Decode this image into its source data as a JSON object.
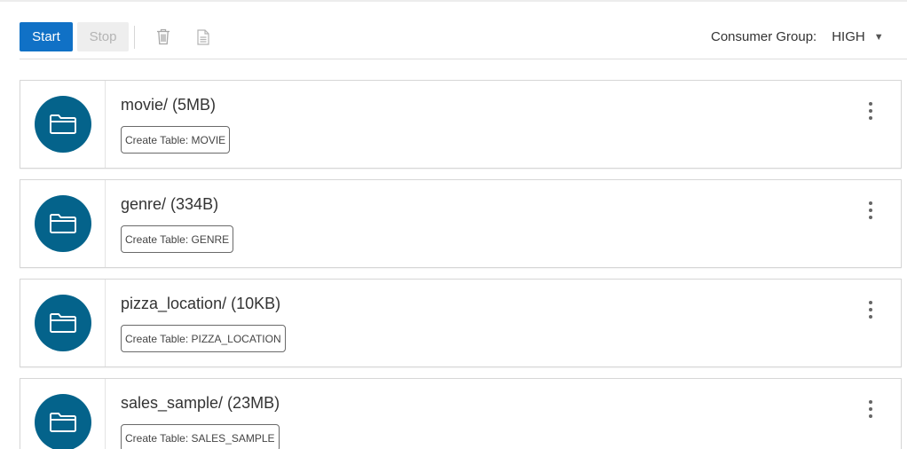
{
  "toolbar": {
    "start_label": "Start",
    "stop_label": "Stop",
    "delete_icon": "trash-icon",
    "log_icon": "document-icon",
    "consumer_group_label": "Consumer Group:",
    "consumer_group_value": "HIGH"
  },
  "colors": {
    "primary": "#1071c6",
    "folder_circle": "#04638b",
    "disabled_bg": "#eeeeee",
    "disabled_text": "#b4b4b4"
  },
  "cards": [
    {
      "title": "movie/ (5MB)",
      "action_label": "Create Table: MOVIE",
      "icon": "folder-icon"
    },
    {
      "title": "genre/ (334B)",
      "action_label": "Create Table: GENRE",
      "icon": "folder-icon"
    },
    {
      "title": "pizza_location/ (10KB)",
      "action_label": "Create Table: PIZZA_LOCATION",
      "icon": "folder-icon"
    },
    {
      "title": "sales_sample/ (23MB)",
      "action_label": "Create Table: SALES_SAMPLE",
      "icon": "folder-icon"
    }
  ]
}
